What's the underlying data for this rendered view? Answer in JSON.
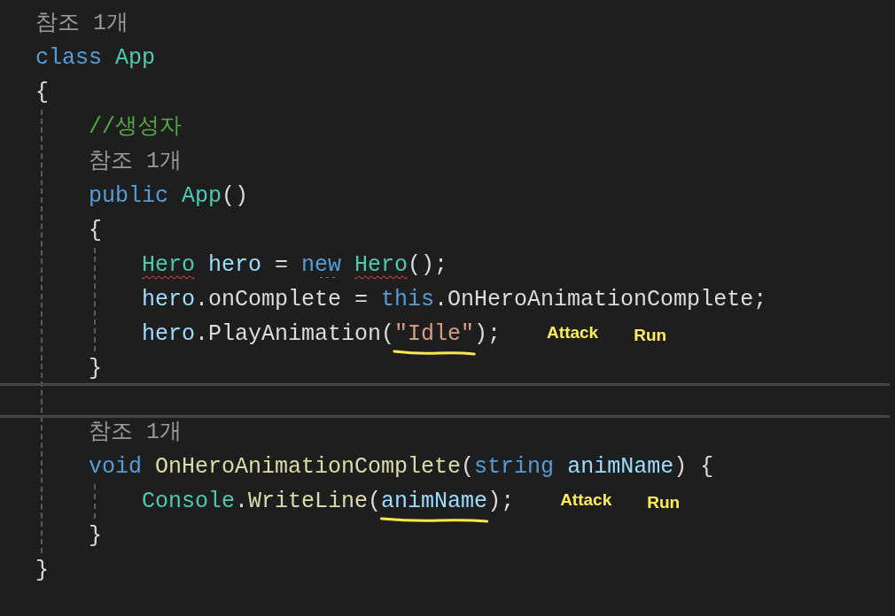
{
  "lines": [
    {
      "kind": "codelens",
      "text": "참조 1개"
    },
    {
      "kind": "code",
      "tokens": [
        {
          "kind": "keyword",
          "text": "class "
        },
        {
          "kind": "type",
          "text": "App"
        }
      ]
    },
    {
      "kind": "code",
      "tokens": [
        {
          "kind": "plain",
          "text": "{"
        }
      ]
    },
    {
      "kind": "block",
      "children": [
        {
          "kind": "code",
          "tokens": [
            {
              "kind": "comment",
              "text": "//생성자"
            }
          ]
        },
        {
          "kind": "codelens",
          "text": "참조 1개"
        },
        {
          "kind": "code",
          "tokens": [
            {
              "kind": "keyword",
              "text": "public "
            },
            {
              "kind": "type",
              "text": "App"
            },
            {
              "kind": "plain",
              "text": "()"
            }
          ]
        },
        {
          "kind": "code",
          "tokens": [
            {
              "kind": "plain",
              "text": "{"
            }
          ]
        },
        {
          "kind": "block",
          "children": [
            {
              "kind": "code",
              "tokens": [
                {
                  "kind": "type",
                  "text": "Hero",
                  "error": true
                },
                {
                  "kind": "local",
                  "text": " hero"
                },
                {
                  "kind": "plain",
                  "text": " = "
                },
                {
                  "kind": "keyword",
                  "text": "new ",
                  "hint": true
                },
                {
                  "kind": "type",
                  "text": "Hero",
                  "error": true
                },
                {
                  "kind": "plain",
                  "text": "();"
                }
              ]
            },
            {
              "kind": "code",
              "tokens": [
                {
                  "kind": "local",
                  "text": "hero"
                },
                {
                  "kind": "plain",
                  "text": ".onComplete = "
                },
                {
                  "kind": "keyword",
                  "text": "this"
                },
                {
                  "kind": "plain",
                  "text": ".OnHeroAnimationComplete;"
                }
              ]
            },
            {
              "kind": "code",
              "tokens": [
                {
                  "kind": "local",
                  "text": "hero"
                },
                {
                  "kind": "plain",
                  "text": ".PlayAnimation("
                },
                {
                  "kind": "string",
                  "text": "\"Idle\"",
                  "marked": true
                },
                {
                  "kind": "plain",
                  "text": ");"
                }
              ],
              "notes": [
                "Attack",
                "Run"
              ]
            }
          ]
        },
        {
          "kind": "code",
          "tokens": [
            {
              "kind": "plain",
              "text": "}"
            }
          ]
        },
        {
          "kind": "separator"
        },
        {
          "kind": "codelens",
          "text": "참조 1개"
        },
        {
          "kind": "code",
          "tokens": [
            {
              "kind": "keyword",
              "text": "void "
            },
            {
              "kind": "method",
              "text": "OnHeroAnimationComplete"
            },
            {
              "kind": "plain",
              "text": "("
            },
            {
              "kind": "keyword",
              "text": "string "
            },
            {
              "kind": "local",
              "text": "animName"
            },
            {
              "kind": "plain",
              "text": ") {"
            }
          ]
        },
        {
          "kind": "block",
          "children": [
            {
              "kind": "code",
              "tokens": [
                {
                  "kind": "type",
                  "text": "Console"
                },
                {
                  "kind": "plain",
                  "text": "."
                },
                {
                  "kind": "method",
                  "text": "WriteLine"
                },
                {
                  "kind": "plain",
                  "text": "("
                },
                {
                  "kind": "local",
                  "text": "animName",
                  "marked": true
                },
                {
                  "kind": "plain",
                  "text": ");"
                }
              ],
              "notes": [
                "Attack",
                "Run"
              ]
            }
          ]
        },
        {
          "kind": "code",
          "tokens": [
            {
              "kind": "plain",
              "text": "}"
            }
          ]
        }
      ]
    },
    {
      "kind": "code",
      "tokens": [
        {
          "kind": "plain",
          "text": "}"
        }
      ]
    }
  ]
}
